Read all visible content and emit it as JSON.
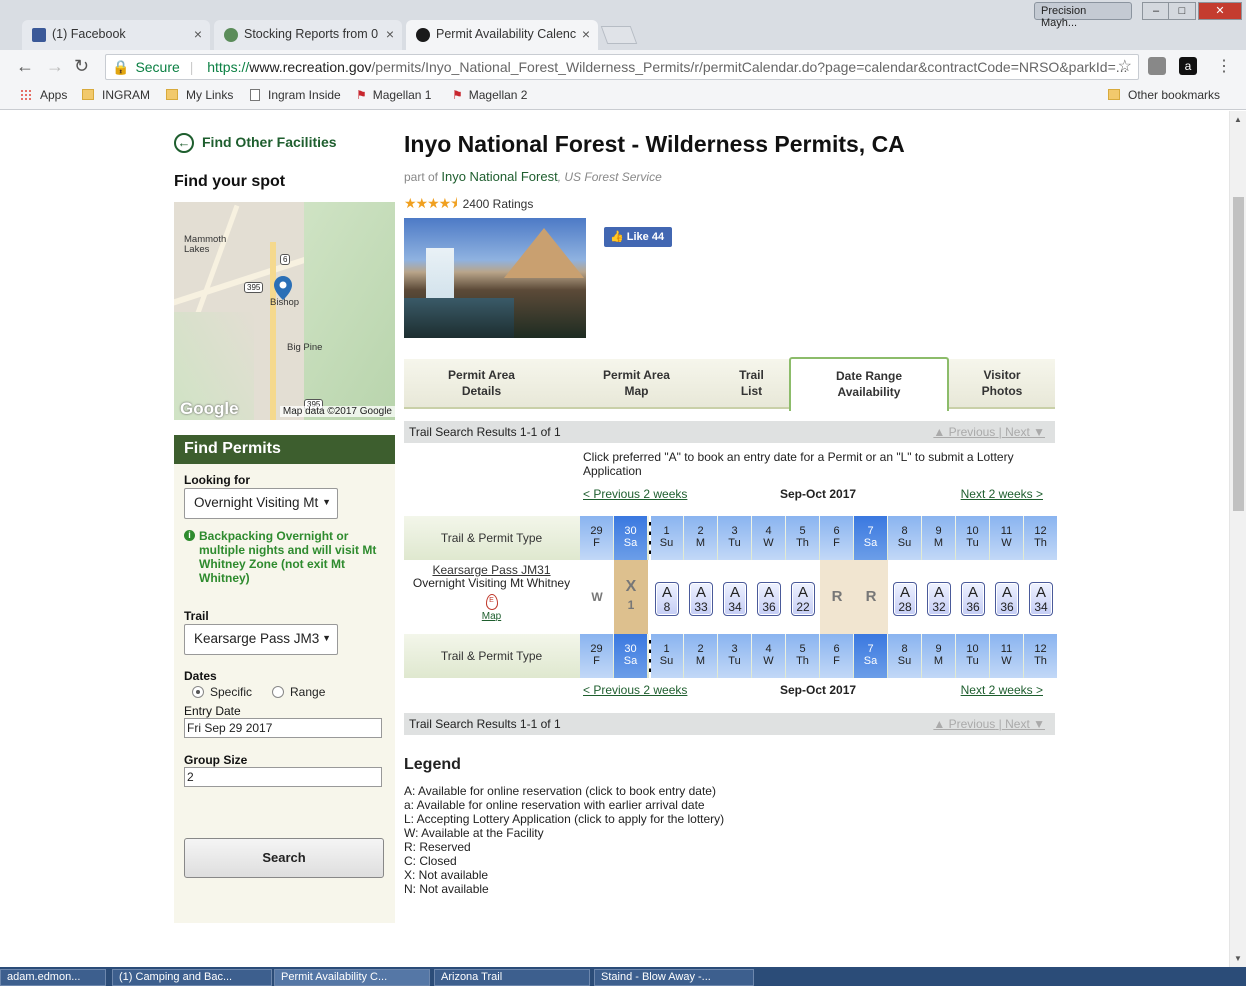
{
  "browser": {
    "tabs": [
      {
        "title": "(1) Facebook",
        "icon": "facebook-icon",
        "color": "#3b5998"
      },
      {
        "title": "Stocking Reports from 0",
        "icon": "globe-icon",
        "color": "#5b8c5a"
      },
      {
        "title": "Permit Availability Calenc",
        "icon": "recreation-gov-icon",
        "color": "#1a1a1a"
      }
    ],
    "profile_name": "Precision Mayh...",
    "secure_label": "Secure",
    "url_prefix": "https://",
    "url_host": "www.recreation.gov",
    "url_path": "/permits/Inyo_National_Forest_Wilderness_Permits/r/permitCalendar.do?page=calendar&contractCode=NRSO&parkId=...",
    "bookmarks": [
      "Apps",
      "INGRAM",
      "My Links",
      "Ingram Inside",
      "Magellan 1",
      "Magellan 2"
    ],
    "other_bookmarks": "Other bookmarks"
  },
  "sidebar": {
    "back_link": "Find Other Facilities",
    "find_spot": "Find your spot",
    "map": {
      "labels": [
        "Mammoth",
        "Lakes",
        "Bishop",
        "Big Pine"
      ],
      "shields": [
        "6",
        "395",
        "395"
      ],
      "google_logo": "Google",
      "attribution": "Map data ©2017 Google"
    },
    "find_permits": "Find Permits",
    "looking_for_label": "Looking for",
    "looking_for_value": "Overnight Visiting Mt",
    "info_text": "Backpacking Overnight or multiple nights and will visit Mt Whitney Zone (not exit Mt Whitney)",
    "trail_label": "Trail",
    "trail_value": "Kearsarge Pass JM3",
    "dates_label": "Dates",
    "radio_specific": "Specific",
    "radio_range": "Range",
    "entry_date_label": "Entry Date",
    "entry_date_value": "Fri Sep 29 2017",
    "group_size_label": "Group Size",
    "group_size_value": "2",
    "search_button": "Search"
  },
  "main": {
    "title": "Inyo National Forest - Wilderness Permits, CA",
    "part_of": "part of",
    "forest_link": "Inyo National Forest",
    "agency": ", US Forest Service",
    "rating_stars": 4.5,
    "ratings_text": "2400 Ratings",
    "like_label": "Like 44",
    "tabs": [
      {
        "line1": "Permit Area",
        "line2": "Details"
      },
      {
        "line1": "Permit Area",
        "line2": "Map"
      },
      {
        "line1": "Trail",
        "line2": "List"
      },
      {
        "line1": "Date Range",
        "line2": "Availability"
      },
      {
        "line1": "Visitor",
        "line2": "Photos"
      }
    ],
    "results_text": "Trail Search Results 1-1 of 1",
    "previous": "▲ Previous",
    "sep": "|",
    "next": "Next ▼",
    "instructions": "Click preferred \"A\" to book an entry date for a Permit or an \"L\" to submit a Lottery Application",
    "prev_weeks": "< Previous 2 weeks",
    "next_weeks": "Next 2 weeks >",
    "period": "Sep-Oct 2017",
    "trail_permit_type": "Trail & Permit Type",
    "dates": [
      {
        "d": "29",
        "w": "F"
      },
      {
        "d": "30",
        "w": "Sa"
      },
      {
        "d": "1",
        "w": "Su"
      },
      {
        "d": "2",
        "w": "M"
      },
      {
        "d": "3",
        "w": "Tu"
      },
      {
        "d": "4",
        "w": "W"
      },
      {
        "d": "5",
        "w": "Th"
      },
      {
        "d": "6",
        "w": "F"
      },
      {
        "d": "7",
        "w": "Sa"
      },
      {
        "d": "8",
        "w": "Su"
      },
      {
        "d": "9",
        "w": "M"
      },
      {
        "d": "10",
        "w": "Tu"
      },
      {
        "d": "11",
        "w": "W"
      },
      {
        "d": "12",
        "w": "Th"
      }
    ],
    "trail_name": "Kearsarge Pass JM31",
    "permit_type": "Overnight Visiting Mt Whitney",
    "map_link": "Map",
    "availability": [
      {
        "code": "W",
        "n": ""
      },
      {
        "code": "X",
        "n": "1"
      },
      {
        "code": "A",
        "n": "8"
      },
      {
        "code": "A",
        "n": "33"
      },
      {
        "code": "A",
        "n": "34"
      },
      {
        "code": "A",
        "n": "36"
      },
      {
        "code": "A",
        "n": "22"
      },
      {
        "code": "R",
        "n": ""
      },
      {
        "code": "R",
        "n": ""
      },
      {
        "code": "A",
        "n": "28"
      },
      {
        "code": "A",
        "n": "32"
      },
      {
        "code": "A",
        "n": "36"
      },
      {
        "code": "A",
        "n": "36"
      },
      {
        "code": "A",
        "n": "34"
      }
    ],
    "legend_title": "Legend",
    "legend": [
      "A: Available for online reservation (click to book entry date)",
      "a: Available for online reservation with earlier arrival date",
      "L: Accepting Lottery Application (click to apply for the lottery)",
      "W: Available at the Facility",
      "R: Reserved",
      "C: Closed",
      "X: Not available",
      "N: Not available"
    ]
  },
  "taskbar": [
    "adam.edmon...",
    "(1) Camping and Bac...",
    "Permit Availability C...",
    "Arizona Trail",
    "Staind - Blow Away -..."
  ]
}
